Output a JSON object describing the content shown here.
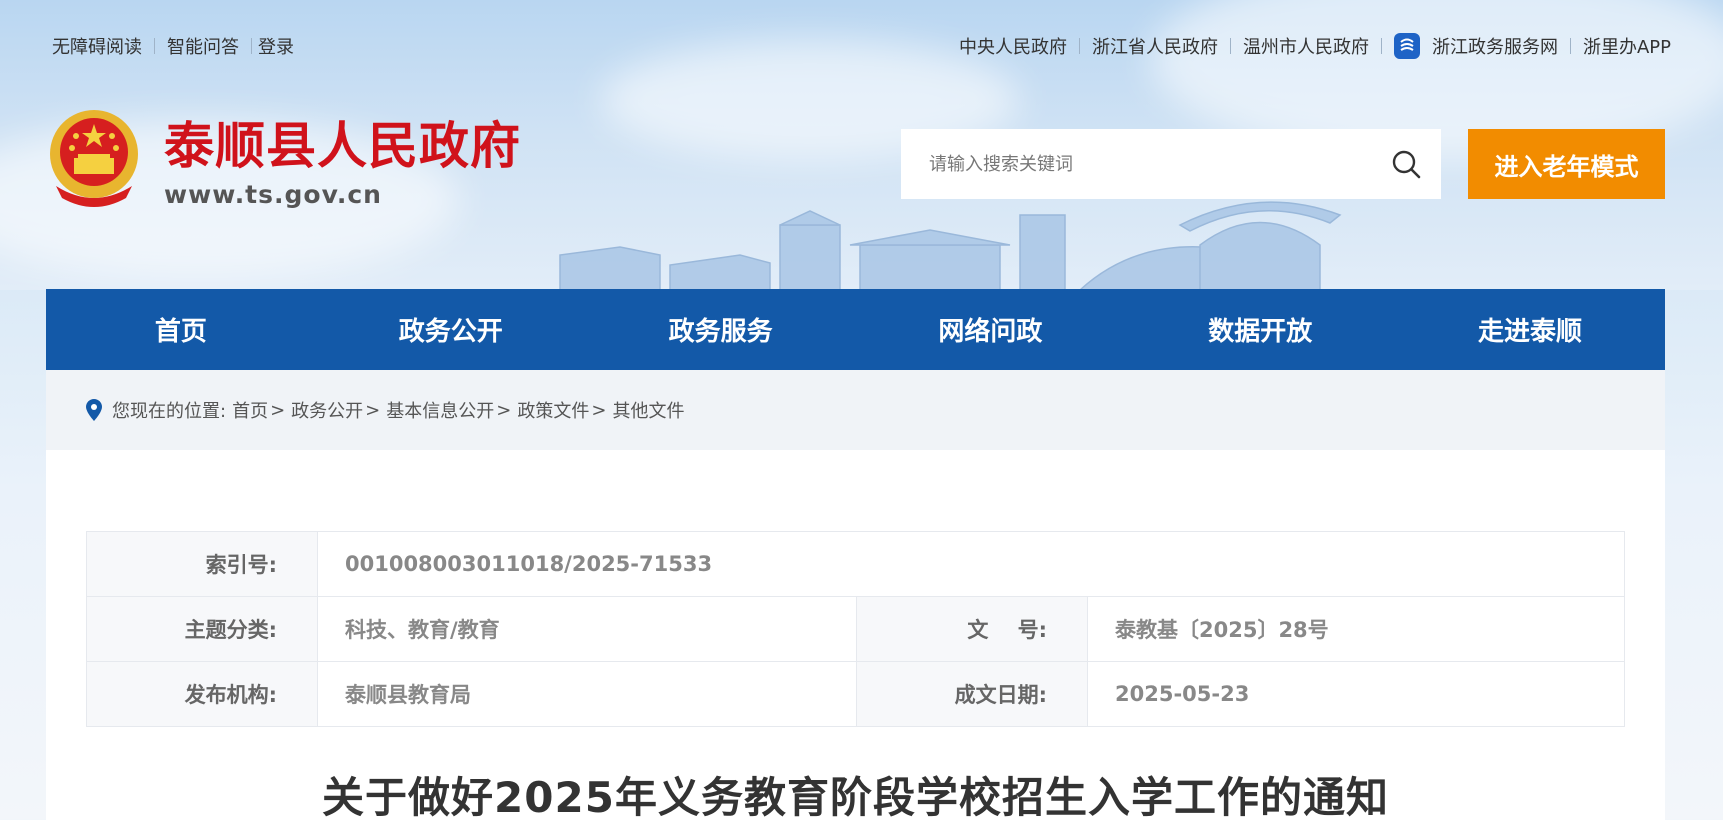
{
  "topbar": {
    "left_links": [
      "无障碍阅读",
      "智能问答",
      "登录"
    ],
    "right_links": [
      "中央人民政府",
      "浙江省人民政府",
      "温州市人民政府",
      "浙江政务服务网",
      "浙里办APP"
    ]
  },
  "header": {
    "site_name": "泰顺县人民政府",
    "site_url": "www.ts.gov.cn",
    "search_placeholder": "请输入搜索关键词",
    "elder_mode_label": "进入老年模式"
  },
  "nav": {
    "items": [
      "首页",
      "政务公开",
      "政务服务",
      "网络问政",
      "数据开放",
      "走进泰顺"
    ]
  },
  "breadcrumb": {
    "prefix": "您现在的位置:",
    "items": [
      "首页",
      "政务公开",
      "基本信息公开",
      "政策文件",
      "其他文件"
    ],
    "separator": ">"
  },
  "meta": {
    "index_label": "索引号:",
    "index_value": "001008003011018/2025-71533",
    "topic_label": "主题分类:",
    "topic_value": "科技、教育/教育",
    "docno_label": "文    号:",
    "docno_value": "泰教基〔2025〕28号",
    "issuer_label": "发布机构:",
    "issuer_value": "泰顺县教育局",
    "date_label": "成文日期:",
    "date_value": "2025-05-23"
  },
  "document": {
    "title": "关于做好2025年义务教育阶段学校招生入学工作的通知"
  },
  "colors": {
    "nav_blue": "#1359a8",
    "brand_red": "#d0121b",
    "elder_orange": "#f28c00"
  }
}
